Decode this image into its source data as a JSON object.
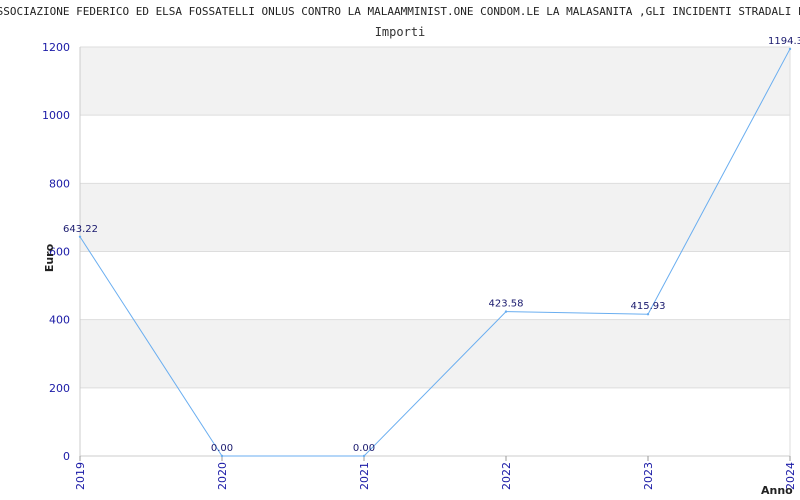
{
  "title": "ASSOCIAZIONE FEDERICO ED ELSA FOSSATELLI ONLUS CONTRO LA MALAAMMINIST.ONE CONDOM.LE LA MALASANITA ,GLI INCIDENTI STRADALI E LA MALAGIUSTIZIA",
  "chart_data": {
    "type": "line",
    "title": "Importi",
    "xlabel": "Anno",
    "ylabel": "Euro",
    "categories": [
      "2019",
      "2020",
      "2021",
      "2022",
      "2023",
      "2024"
    ],
    "series": [
      {
        "values": [
          643.22,
          0.0,
          0.0,
          423.58,
          415.93,
          1194.3
        ]
      }
    ],
    "data_labels": [
      "643.22",
      "0.00",
      "0.00",
      "423.58",
      "415.93",
      "1194.3"
    ],
    "ylim": [
      0,
      1200
    ],
    "yticks": [
      0,
      200,
      400,
      600,
      800,
      1000,
      1200
    ],
    "grid": true,
    "line_color": "#6aaef0",
    "band_color": "#f2f2f2",
    "tick_color": "#1a1aa6"
  }
}
